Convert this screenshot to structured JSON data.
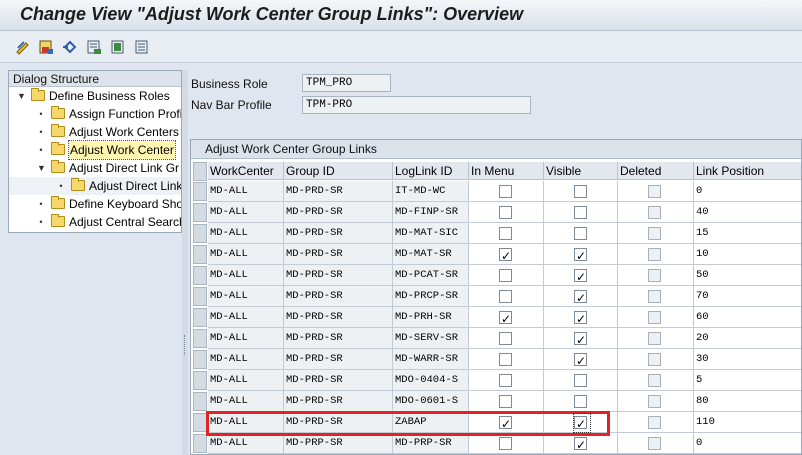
{
  "window": {
    "title": "Change View \"Adjust Work Center Group Links\": Overview"
  },
  "toolbar": {
    "icons": [
      "display-change-icon",
      "save-icon",
      "undo-icon",
      "select-block-icon",
      "select-all-icon",
      "deselect-all-icon"
    ]
  },
  "dialog_structure": {
    "header": "Dialog Structure",
    "items": [
      {
        "label": "Define Business Roles",
        "level": 0,
        "expanded": true
      },
      {
        "label": "Assign Function Profi",
        "level": 1
      },
      {
        "label": "Adjust Work Centers",
        "level": 1
      },
      {
        "label": "Adjust Work Center",
        "level": 1,
        "selected": true
      },
      {
        "label": "Adjust Direct Link Gr",
        "level": 1,
        "expanded": true
      },
      {
        "label": "Adjust Direct Link",
        "level": 2
      },
      {
        "label": "Define Keyboard Sho",
        "level": 1
      },
      {
        "label": "Adjust Central Search",
        "level": 1
      }
    ]
  },
  "form": {
    "business_role_label": "Business Role",
    "business_role_value": "TPM_PRO",
    "nav_bar_profile_label": "Nav Bar Profile",
    "nav_bar_profile_value": "TPM-PRO"
  },
  "table": {
    "title": "Adjust Work Center Group Links",
    "columns": [
      "WorkCenter",
      "Group ID",
      "LogLink ID",
      "In Menu",
      "Visible",
      "Deleted",
      "Link Position"
    ],
    "rows": [
      {
        "work_center": "MD-ALL",
        "group_id": "MD-PRD-SR",
        "loglink_id": "IT-MD-WC",
        "in_menu": false,
        "visible": false,
        "deleted": false,
        "link_position": "0"
      },
      {
        "work_center": "MD-ALL",
        "group_id": "MD-PRD-SR",
        "loglink_id": "MD-FINP-SR",
        "in_menu": false,
        "visible": false,
        "deleted": false,
        "link_position": "40"
      },
      {
        "work_center": "MD-ALL",
        "group_id": "MD-PRD-SR",
        "loglink_id": "MD-MAT-SIC",
        "in_menu": false,
        "visible": false,
        "deleted": false,
        "link_position": "15"
      },
      {
        "work_center": "MD-ALL",
        "group_id": "MD-PRD-SR",
        "loglink_id": "MD-MAT-SR",
        "in_menu": true,
        "visible": true,
        "deleted": false,
        "link_position": "10"
      },
      {
        "work_center": "MD-ALL",
        "group_id": "MD-PRD-SR",
        "loglink_id": "MD-PCAT-SR",
        "in_menu": false,
        "visible": true,
        "deleted": false,
        "link_position": "50"
      },
      {
        "work_center": "MD-ALL",
        "group_id": "MD-PRD-SR",
        "loglink_id": "MD-PRCP-SR",
        "in_menu": false,
        "visible": true,
        "deleted": false,
        "link_position": "70"
      },
      {
        "work_center": "MD-ALL",
        "group_id": "MD-PRD-SR",
        "loglink_id": "MD-PRH-SR",
        "in_menu": true,
        "visible": true,
        "deleted": false,
        "link_position": "60"
      },
      {
        "work_center": "MD-ALL",
        "group_id": "MD-PRD-SR",
        "loglink_id": "MD-SERV-SR",
        "in_menu": false,
        "visible": true,
        "deleted": false,
        "link_position": "20"
      },
      {
        "work_center": "MD-ALL",
        "group_id": "MD-PRD-SR",
        "loglink_id": "MD-WARR-SR",
        "in_menu": false,
        "visible": true,
        "deleted": false,
        "link_position": "30"
      },
      {
        "work_center": "MD-ALL",
        "group_id": "MD-PRD-SR",
        "loglink_id": "MDO-0404-S",
        "in_menu": false,
        "visible": false,
        "deleted": false,
        "link_position": "5"
      },
      {
        "work_center": "MD-ALL",
        "group_id": "MD-PRD-SR",
        "loglink_id": "MDO-0601-S",
        "in_menu": false,
        "visible": false,
        "deleted": false,
        "link_position": "80"
      },
      {
        "work_center": "MD-ALL",
        "group_id": "MD-PRD-SR",
        "loglink_id": "ZABAP",
        "in_menu": true,
        "visible": true,
        "deleted": false,
        "link_position": "110"
      },
      {
        "work_center": "MD-ALL",
        "group_id": "MD-PRP-SR",
        "loglink_id": "MD-PRP-SR",
        "in_menu": false,
        "visible": true,
        "deleted": false,
        "link_position": "0"
      }
    ]
  },
  "colors": {
    "highlight": "#e02424",
    "background": "#dfe6ef"
  }
}
